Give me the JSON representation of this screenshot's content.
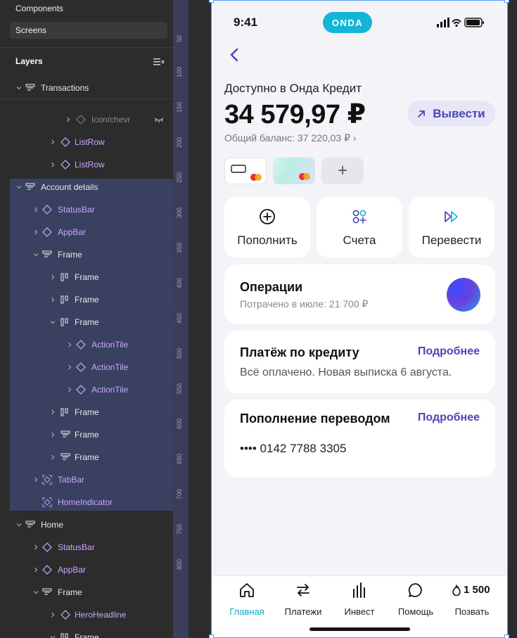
{
  "panel": {
    "nav": {
      "components": "Components",
      "screens": "Screens"
    },
    "layers_title": "Layers",
    "layers": [
      {
        "label": "Transactions",
        "kind": "frame"
      },
      {
        "label": "Icon/chevr",
        "kind": "dim"
      },
      {
        "label": "ListRow",
        "kind": "comp"
      },
      {
        "label": "ListRow",
        "kind": "comp"
      },
      {
        "label": "Account details",
        "kind": "frame"
      },
      {
        "label": "StatusBar",
        "kind": "comp"
      },
      {
        "label": "AppBar",
        "kind": "comp"
      },
      {
        "label": "Frame",
        "kind": "frame"
      },
      {
        "label": "Frame",
        "kind": "frame"
      },
      {
        "label": "Frame",
        "kind": "frame"
      },
      {
        "label": "Frame",
        "kind": "frame"
      },
      {
        "label": "ActionTile",
        "kind": "comp"
      },
      {
        "label": "ActionTile",
        "kind": "comp"
      },
      {
        "label": "ActionTile",
        "kind": "comp"
      },
      {
        "label": "Frame",
        "kind": "frame"
      },
      {
        "label": "Frame",
        "kind": "frame"
      },
      {
        "label": "Frame",
        "kind": "frame"
      },
      {
        "label": "TabBar",
        "kind": "comp"
      },
      {
        "label": "HomeIndicator",
        "kind": "comp"
      },
      {
        "label": "Home",
        "kind": "frame"
      },
      {
        "label": "StatusBar",
        "kind": "comp"
      },
      {
        "label": "AppBar",
        "kind": "comp"
      },
      {
        "label": "Frame",
        "kind": "frame"
      },
      {
        "label": "HeroHeadline",
        "kind": "comp"
      },
      {
        "label": "Frame",
        "kind": "frame"
      }
    ]
  },
  "ruler": [
    "50",
    "100",
    "150",
    "200",
    "250",
    "300",
    "350",
    "400",
    "450",
    "500",
    "550",
    "600",
    "650",
    "700",
    "750",
    "800"
  ],
  "phone": {
    "status": {
      "time": "9:41",
      "brand": "ONDA"
    },
    "available_label": "Доступно в Онда Кредит",
    "amount": "34 579,97 ₽",
    "total_balance": "Общий баланс: 37 220,03 ₽ ›",
    "withdraw_label": "Вывести",
    "add_card": "+",
    "actions": [
      {
        "label": "Пополнить",
        "icon": "plus-circle-icon"
      },
      {
        "label": "Счета",
        "icon": "accounts-icon"
      },
      {
        "label": "Перевести",
        "icon": "fast-forward-icon"
      }
    ],
    "operations": {
      "title": "Операции",
      "subtitle": "Потрачено в июле: 21 700 ₽"
    },
    "credit_payment": {
      "title": "Платёж по кредиту",
      "link": "Подробнее",
      "body": "Всё оплачено. Новая выписка 6 августа."
    },
    "topup_transfer": {
      "title": "Пополнение переводом",
      "link": "Подробнее",
      "account": "•••• 0142 7788 3305"
    },
    "tabs": [
      {
        "label": "Главная",
        "icon": "home-icon",
        "active": true
      },
      {
        "label": "Платежи",
        "icon": "transfer-arrows-icon",
        "active": false
      },
      {
        "label": "Инвест",
        "icon": "bar-chart-icon",
        "active": false
      },
      {
        "label": "Помощь",
        "icon": "chat-bubble-icon",
        "active": false
      },
      {
        "label": "Позвать",
        "icon": "flame-icon",
        "active": false,
        "badge": "1 500"
      }
    ]
  },
  "colors": {
    "accent": "#4b45b8",
    "brand": "#13b6d6",
    "tab_active": "#13a9c9",
    "selection": "#4d9cff"
  }
}
